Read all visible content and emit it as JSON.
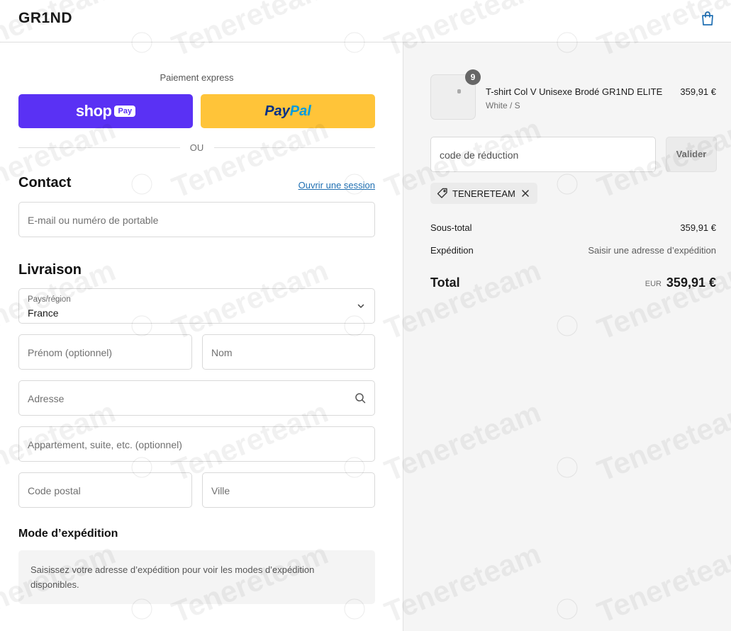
{
  "header": {
    "brand": "GR1ND"
  },
  "express": {
    "label": "Paiement express",
    "shop_word": "shop",
    "shop_pay": "Pay",
    "paypal_a": "Pay",
    "paypal_b": "Pal",
    "or": "OU"
  },
  "contact": {
    "title": "Contact",
    "login_link": "Ouvrir une session",
    "email_placeholder": "E-mail ou numéro de portable"
  },
  "delivery": {
    "title": "Livraison",
    "country_label": "Pays/région",
    "country_value": "France",
    "first_name": "Prénom (optionnel)",
    "last_name": "Nom",
    "address": "Adresse",
    "apartment": "Appartement, suite, etc. (optionnel)",
    "postal_code": "Code postal",
    "city": "Ville"
  },
  "shipping": {
    "title": "Mode d’expédition",
    "note_line1": "Saisissez votre adresse d’expédition pour voir les modes d’expédition",
    "note_line2": "disponibles."
  },
  "summary": {
    "product": {
      "quantity": "9",
      "name": "T-shirt Col V Unisexe Brodé GR1ND ELITE",
      "variant": "White / S",
      "price": "359,91 €"
    },
    "discount_placeholder": "code de réduction",
    "apply_label": "Valider",
    "applied_code": "TENERETEAM",
    "subtotal_label": "Sous-total",
    "subtotal_value": "359,91 €",
    "shipping_label": "Expédition",
    "shipping_value": "Saisir une adresse d’expédition",
    "total_label": "Total",
    "currency": "EUR",
    "total_value": "359,91 €"
  },
  "watermark": {
    "text": "Tenereteam"
  },
  "icons": {
    "cart": "shopping-bag-icon",
    "chevron": "chevron-down-icon",
    "search": "search-icon",
    "tag": "tag-icon",
    "close": "close-icon"
  },
  "colors": {
    "shop_pay": "#5a31f4",
    "paypal": "#ffc439",
    "link": "#1f6fb2",
    "cart_icon": "#1f6fb2"
  }
}
